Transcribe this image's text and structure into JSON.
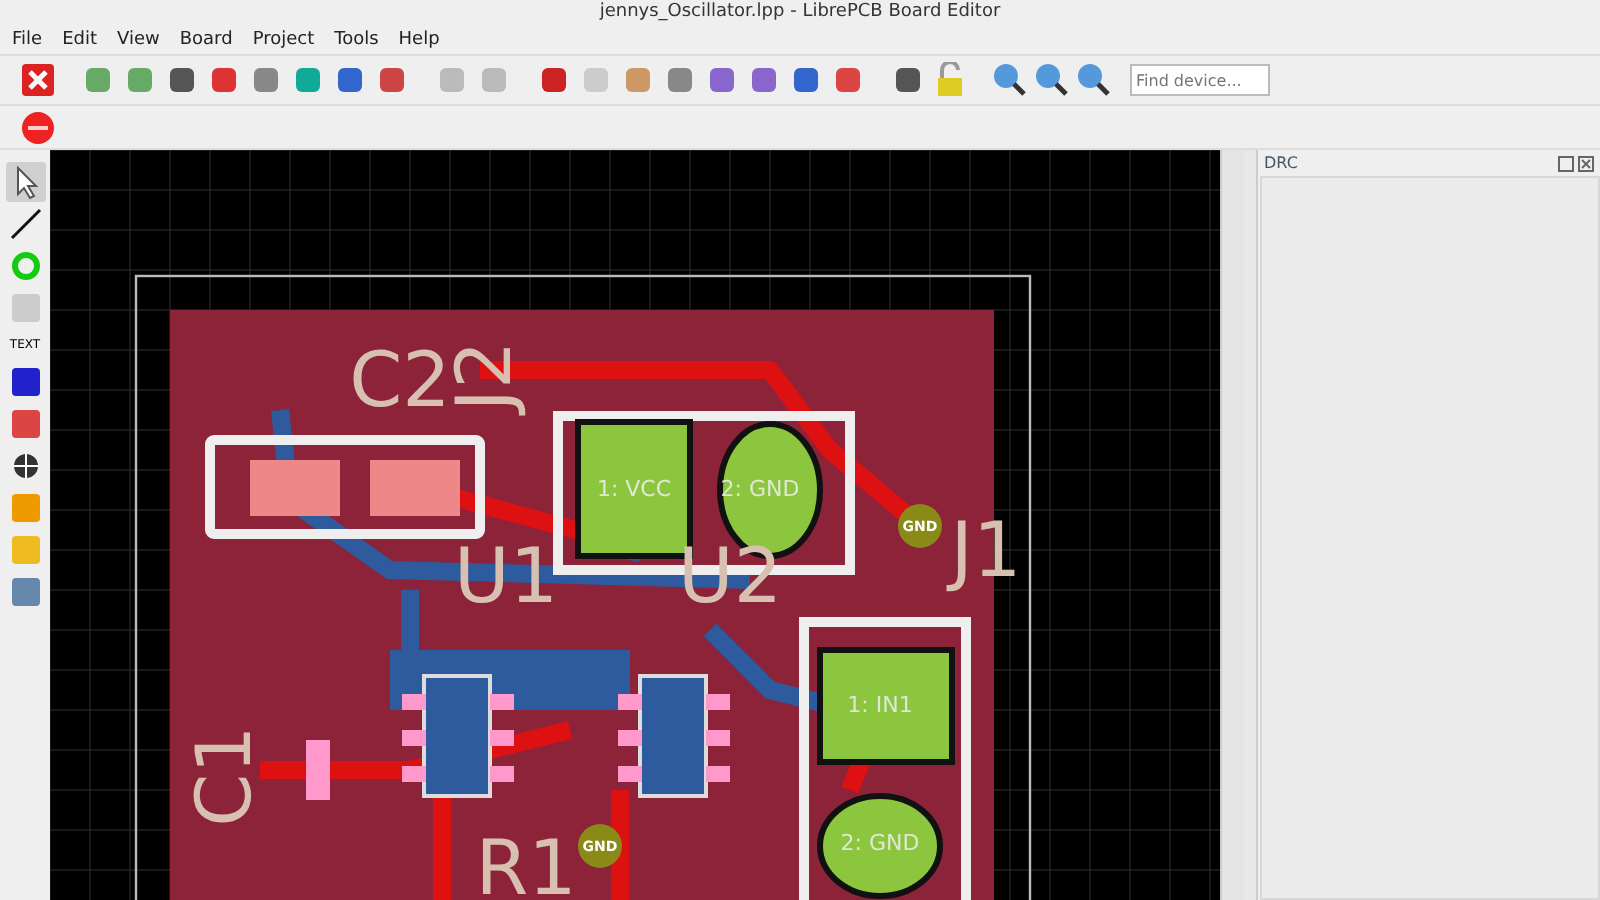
{
  "window": {
    "title": "jennys_Oscillator.lpp - LibrePCB Board Editor"
  },
  "menu": [
    "File",
    "Edit",
    "View",
    "Board",
    "Project",
    "Tools",
    "Help"
  ],
  "toolbar": {
    "search": {
      "placeholder": "Find device..."
    }
  },
  "left_toolbar": [
    {
      "kind": "icon",
      "selected": true
    },
    {
      "kind": "icon",
      "selected": false
    },
    {
      "kind": "icon",
      "selected": false
    },
    {
      "kind": "icon",
      "selected": false
    },
    {
      "kind": "text",
      "label": "TEXT",
      "selected": false
    },
    {
      "kind": "icon",
      "selected": false
    },
    {
      "kind": "icon",
      "selected": false
    },
    {
      "kind": "icon",
      "selected": false
    },
    {
      "kind": "icon",
      "selected": false
    },
    {
      "kind": "icon",
      "selected": false
    },
    {
      "kind": "icon",
      "selected": false
    }
  ],
  "board": {
    "designators": [
      "C2",
      "J2",
      "U1",
      "U2",
      "J1",
      "C1",
      "R1"
    ],
    "pads": [
      "1: VCC",
      "2: GND",
      "1: IN1",
      "2: GND"
    ],
    "vias": [
      "GND",
      "GND"
    ]
  },
  "drc_panel": {
    "title": "DRC"
  }
}
